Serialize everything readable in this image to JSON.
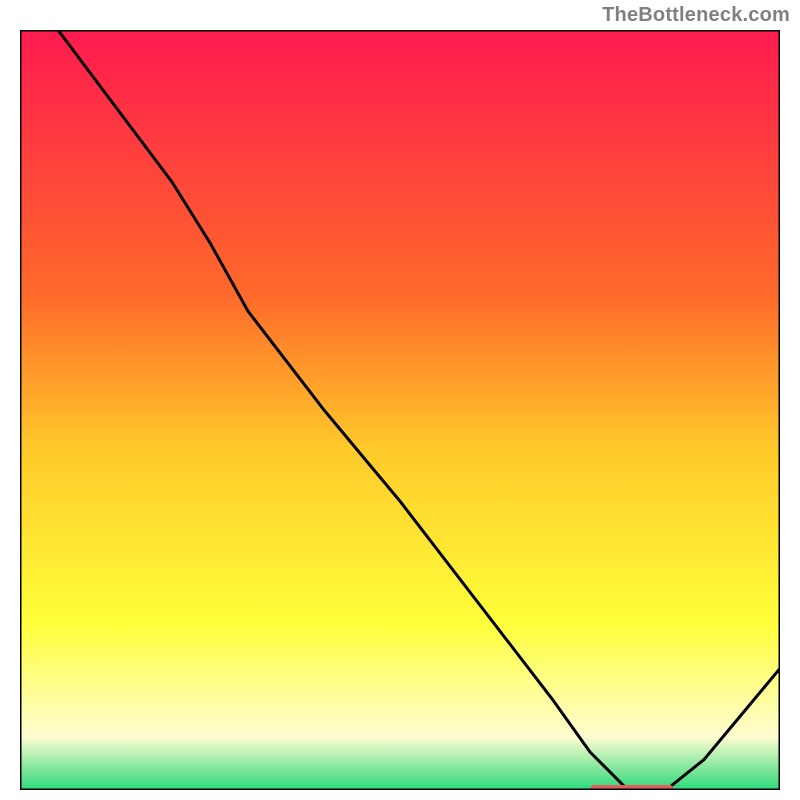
{
  "watermark": "TheBottleneck.com",
  "colors": {
    "gradient_top": "#ff1a4f",
    "gradient_mid_upper": "#ff6a2a",
    "gradient_mid": "#ffc92a",
    "gradient_mid_lower": "#ffff3a",
    "gradient_cream": "#fffcd0",
    "gradient_bottom": "#2cd97a",
    "curve": "#000000",
    "marker": "#e05e5b",
    "frame": "#000000"
  },
  "chart_data": {
    "type": "line",
    "title": "",
    "xlabel": "",
    "ylabel": "",
    "xlim": [
      0,
      100
    ],
    "ylim": [
      0,
      100
    ],
    "x": [
      0,
      5,
      20,
      25,
      30,
      40,
      50,
      60,
      70,
      75,
      80,
      85,
      90,
      95,
      100
    ],
    "values": [
      105,
      100,
      80,
      72,
      63,
      50,
      38,
      25,
      12,
      5,
      0,
      0,
      4,
      10,
      16
    ],
    "marker_range_x": [
      75,
      86
    ],
    "marker_y": 0,
    "annotations": []
  }
}
